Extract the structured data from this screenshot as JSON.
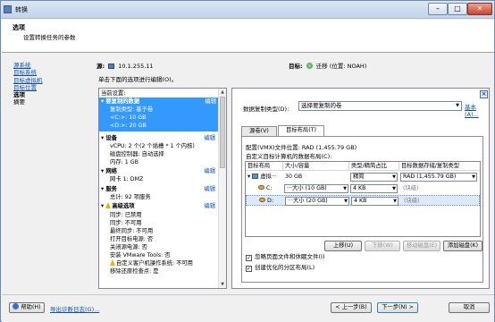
{
  "window": {
    "title": "转换"
  },
  "header": {
    "title": "选项",
    "subtitle": "设置转换任务的参数"
  },
  "nav": {
    "items": [
      {
        "label": "源系统",
        "link": true
      },
      {
        "label": "目标系统",
        "link": true
      },
      {
        "label": "目标虚拟机",
        "link": true
      },
      {
        "label": "目标位置",
        "link": true
      },
      {
        "label": "选项",
        "link": false
      },
      {
        "label": "摘要",
        "link": false
      }
    ]
  },
  "source": {
    "label": "源:",
    "value": "10.1.255.11"
  },
  "target": {
    "label": "目标:",
    "value": "迁移 (位置: NOAH)"
  },
  "hint": "单击下面的选项进行编辑(O)。",
  "left_panel": {
    "current_settings": "当前设置:",
    "edit_label": "编辑",
    "rows": [
      {
        "text": "要复制的数据",
        "bold": true
      },
      {
        "text": "复制类型: 基于卷"
      },
      {
        "text": "<C:>: 10 GB"
      },
      {
        "text": "<D:>: 20 GB"
      },
      {
        "text": "设备",
        "bold": true
      },
      {
        "text": "vCPU: 2 个(2 个插槽 * 1 个内核)"
      },
      {
        "text": "磁盘控制器: 自动选择"
      },
      {
        "text": "内存: 1 GB"
      },
      {
        "text": "网络",
        "bold": true
      },
      {
        "text": "网卡 1: DMZ"
      },
      {
        "text": "服务",
        "bold": true
      },
      {
        "text": "总计: 92 项服务"
      },
      {
        "text": "高级选项",
        "bold": true
      },
      {
        "text": "同步: 已禁用"
      },
      {
        "text": "同步: 不可用"
      },
      {
        "text": "最终同步: 不可用"
      },
      {
        "text": "打开目标电源: 否"
      },
      {
        "text": "关闭源电源: 否"
      },
      {
        "text": "安装 VMware Tools: 否"
      },
      {
        "text": "自定义客户机操作系统: 不可用"
      },
      {
        "text": "移除还原检查点: 是"
      }
    ]
  },
  "right_panel": {
    "close_symbol": "×",
    "copy_type_label": "数据复制类型(D):",
    "copy_type_value": "选择要复制的卷",
    "basic_link": "基本(A)...",
    "tabs": [
      {
        "label": "源卷(V)"
      },
      {
        "label": "目标布局(T)"
      }
    ],
    "vm_folder": "配置(VMX)文件位置: RAD (1,455.79 GB)",
    "custom_location": "自定义目标计算机的数据布局(C):",
    "table": {
      "headers": [
        "目标布局",
        "大小/容量",
        "类型/精简占比",
        "目标数据存储/复制类型"
      ],
      "rows": [
        {
          "name": "虚拟···",
          "size": "30 GB",
          "type": "精简",
          "store": "RAD (1,455.79 GB)"
        },
        {
          "name": "C:",
          "size": "···大小 (10 GB)",
          "type": "4 KB",
          "store": "(块级)"
        },
        {
          "name": "D:",
          "size": "···大小 (20 GB)",
          "type": "4 KB",
          "store": "(块级)"
        }
      ]
    },
    "buttons": {
      "up": "上移(U)",
      "down": "下移(W)",
      "move_disk": "移动磁盘(E)",
      "add_disk": "添加磁盘(K)"
    },
    "checkboxes": [
      {
        "label": "忽略页面文件和休眠文件(I)",
        "checked": true
      },
      {
        "label": "创建优化的分区布局(L)",
        "checked": true
      }
    ]
  },
  "bottom": {
    "help": "帮助(H)",
    "export": "导出诊断日志(G)...",
    "back": "< 上一步(B)",
    "next": "下一步(N) >",
    "cancel": "取消"
  }
}
